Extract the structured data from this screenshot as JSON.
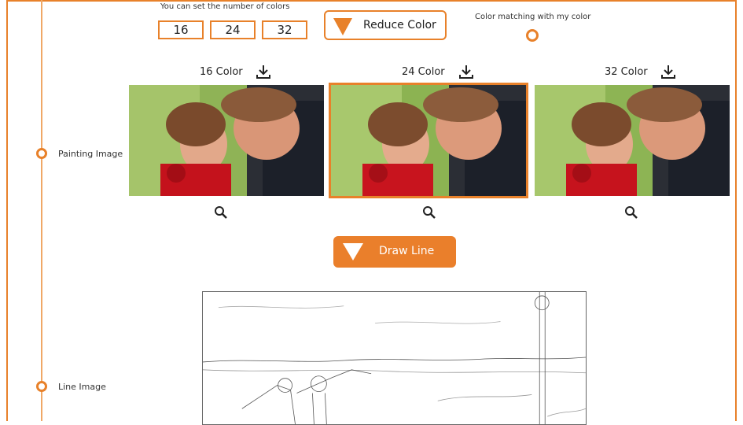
{
  "controls": {
    "set_label": "You can set the number of colors",
    "options": [
      "16",
      "24",
      "32"
    ],
    "reduce_label": "Reduce Color",
    "match_label": "Color matching with my color"
  },
  "timeline": {
    "painting_label": "Painting Image",
    "line_label": "Line Image"
  },
  "columns": [
    {
      "title": "16 Color",
      "selected": false
    },
    {
      "title": "24 Color",
      "selected": true
    },
    {
      "title": "32 Color",
      "selected": false
    }
  ],
  "draw_button": {
    "label": "Draw Line"
  },
  "icons": {
    "download": "download-icon",
    "zoom": "magnifier-icon",
    "arrow": "triangle-down-icon"
  },
  "colors": {
    "accent": "#e8812a"
  }
}
